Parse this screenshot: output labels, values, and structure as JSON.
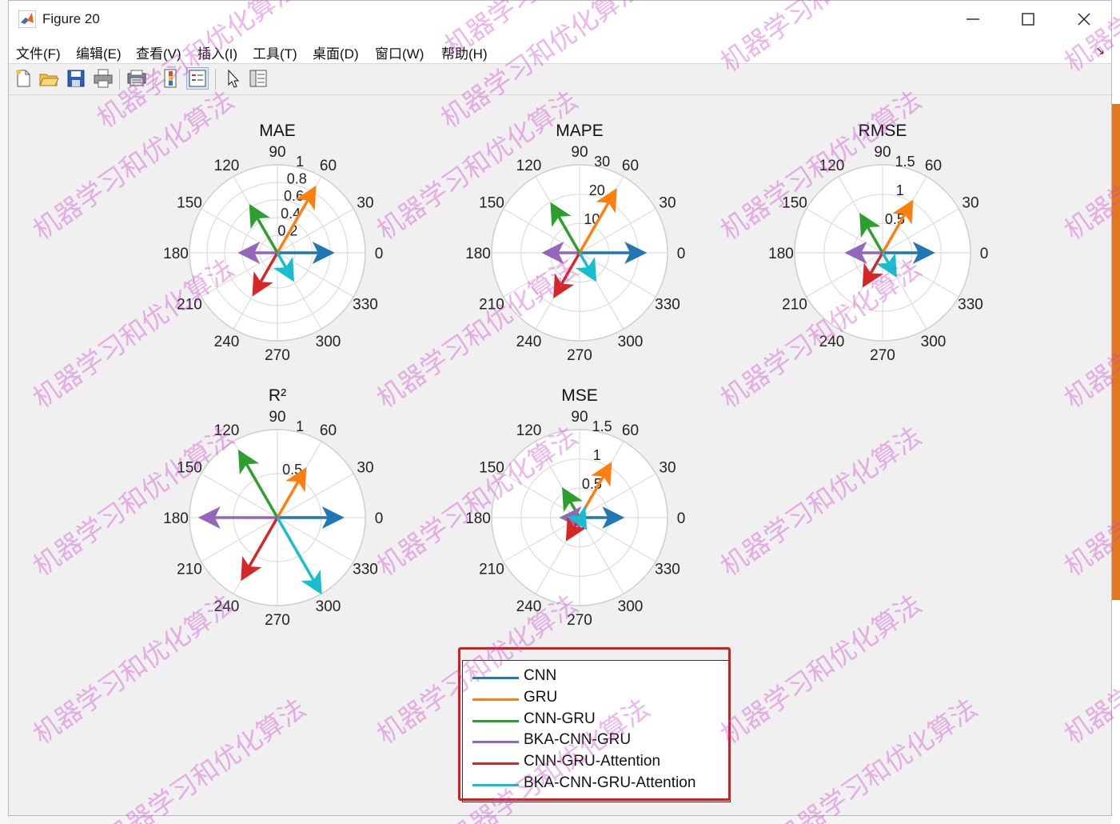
{
  "window": {
    "title": "Figure 20",
    "menu": [
      "文件(F)",
      "编辑(E)",
      "查看(V)",
      "插入(I)",
      "工具(T)",
      "桌面(D)",
      "窗口(W)",
      "帮助(H)"
    ],
    "toolbar_icons": [
      "new-figure-icon",
      "open-icon",
      "save-icon",
      "print-icon",
      "print-preview-icon",
      "insert-colorbar-icon",
      "insert-legend-icon",
      "edit-plot-arrow-icon",
      "property-inspector-icon"
    ]
  },
  "colors": {
    "CNN": "#1f77b4",
    "GRU": "#ff7f0e",
    "CNN-GRU": "#2ca02c",
    "BKA-CNN-GRU": "#9467bd",
    "CNN-GRU-Attention": "#d62728",
    "BKA-CNN-GRU-Attention": "#17becf",
    "highlight": "#e3161a"
  },
  "watermark": "机器学习和优化算法",
  "chart_data": [
    {
      "type": "compass",
      "title": "MAE",
      "rmax": 1,
      "rticks": [
        0.2,
        0.4,
        0.6,
        0.8,
        1
      ],
      "rtick_labels": [
        "0.2",
        "0.4",
        "0.6",
        "0.8",
        "1"
      ],
      "theta_ticks": [
        "0",
        "30",
        "60",
        "90",
        "120",
        "150",
        "180",
        "210",
        "240",
        "300",
        "270",
        "330"
      ],
      "series": [
        {
          "name": "CNN",
          "angle": 0,
          "magnitude": 0.62
        },
        {
          "name": "GRU",
          "angle": 60,
          "magnitude": 0.85
        },
        {
          "name": "CNN-GRU",
          "angle": 120,
          "magnitude": 0.61
        },
        {
          "name": "BKA-CNN-GRU",
          "angle": 180,
          "magnitude": 0.42
        },
        {
          "name": "CNN-GRU-Attention",
          "angle": 240,
          "magnitude": 0.54
        },
        {
          "name": "BKA-CNN-GRU-Attention",
          "angle": 300,
          "magnitude": 0.35
        }
      ]
    },
    {
      "type": "compass",
      "title": "MAPE",
      "rmax": 30,
      "rticks": [
        10,
        20,
        30
      ],
      "rtick_labels": [
        "10",
        "20",
        "30"
      ],
      "theta_ticks": [
        "0",
        "30",
        "60",
        "90",
        "120",
        "150",
        "180",
        "210",
        "240",
        "300",
        "270",
        "330"
      ],
      "series": [
        {
          "name": "CNN",
          "angle": 0,
          "magnitude": 22.0
        },
        {
          "name": "GRU",
          "angle": 60,
          "magnitude": 24.5
        },
        {
          "name": "CNN-GRU",
          "angle": 120,
          "magnitude": 19.0
        },
        {
          "name": "BKA-CNN-GRU",
          "angle": 180,
          "magnitude": 12.0
        },
        {
          "name": "CNN-GRU-Attention",
          "angle": 240,
          "magnitude": 17.0
        },
        {
          "name": "BKA-CNN-GRU-Attention",
          "angle": 300,
          "magnitude": 10.5
        }
      ]
    },
    {
      "type": "compass",
      "title": "RMSE",
      "rmax": 1.5,
      "rticks": [
        0.5,
        1,
        1.5
      ],
      "rtick_labels": [
        "0.5",
        "1",
        "1.5"
      ],
      "theta_ticks": [
        "0",
        "30",
        "60",
        "90",
        "120",
        "150",
        "180",
        "210",
        "240",
        "300",
        "270",
        "330"
      ],
      "series": [
        {
          "name": "CNN",
          "angle": 0,
          "magnitude": 0.85
        },
        {
          "name": "GRU",
          "angle": 60,
          "magnitude": 1.0
        },
        {
          "name": "CNN-GRU",
          "angle": 120,
          "magnitude": 0.74
        },
        {
          "name": "BKA-CNN-GRU",
          "angle": 180,
          "magnitude": 0.6
        },
        {
          "name": "CNN-GRU-Attention",
          "angle": 240,
          "magnitude": 0.64
        },
        {
          "name": "BKA-CNN-GRU-Attention",
          "angle": 300,
          "magnitude": 0.44
        }
      ]
    },
    {
      "type": "compass",
      "title": "R²",
      "rmax": 1,
      "rticks": [
        0.5,
        1
      ],
      "rtick_labels": [
        "0.5",
        "1"
      ],
      "theta_ticks": [
        "0",
        "30",
        "60",
        "90",
        "120",
        "150",
        "180",
        "210",
        "240",
        "300",
        "270",
        "330"
      ],
      "series": [
        {
          "name": "CNN",
          "angle": 0,
          "magnitude": 0.73
        },
        {
          "name": "GRU",
          "angle": 60,
          "magnitude": 0.63
        },
        {
          "name": "CNN-GRU",
          "angle": 120,
          "magnitude": 0.86
        },
        {
          "name": "BKA-CNN-GRU",
          "angle": 180,
          "magnitude": 0.87
        },
        {
          "name": "CNN-GRU-Attention",
          "angle": 240,
          "magnitude": 0.8
        },
        {
          "name": "BKA-CNN-GRU-Attention",
          "angle": 300,
          "magnitude": 0.98
        }
      ]
    },
    {
      "type": "compass",
      "title": "MSE",
      "rmax": 1.5,
      "rticks": [
        0.5,
        1,
        1.5
      ],
      "rtick_labels": [
        "0.5",
        "1",
        "1.5"
      ],
      "theta_ticks": [
        "0",
        "30",
        "60",
        "90",
        "120",
        "150",
        "180",
        "210",
        "240",
        "300",
        "270",
        "330"
      ],
      "series": [
        {
          "name": "CNN",
          "angle": 0,
          "magnitude": 0.72
        },
        {
          "name": "GRU",
          "angle": 60,
          "magnitude": 1.05
        },
        {
          "name": "CNN-GRU",
          "angle": 120,
          "magnitude": 0.55
        },
        {
          "name": "BKA-CNN-GRU",
          "angle": 180,
          "magnitude": 0.3
        },
        {
          "name": "CNN-GRU-Attention",
          "angle": 240,
          "magnitude": 0.42
        },
        {
          "name": "BKA-CNN-GRU-Attention",
          "angle": 300,
          "magnitude": 0.2
        }
      ]
    }
  ],
  "legend": [
    "CNN",
    "GRU",
    "CNN-GRU",
    "BKA-CNN-GRU",
    "CNN-GRU-Attention",
    "BKA-CNN-GRU-Attention"
  ]
}
